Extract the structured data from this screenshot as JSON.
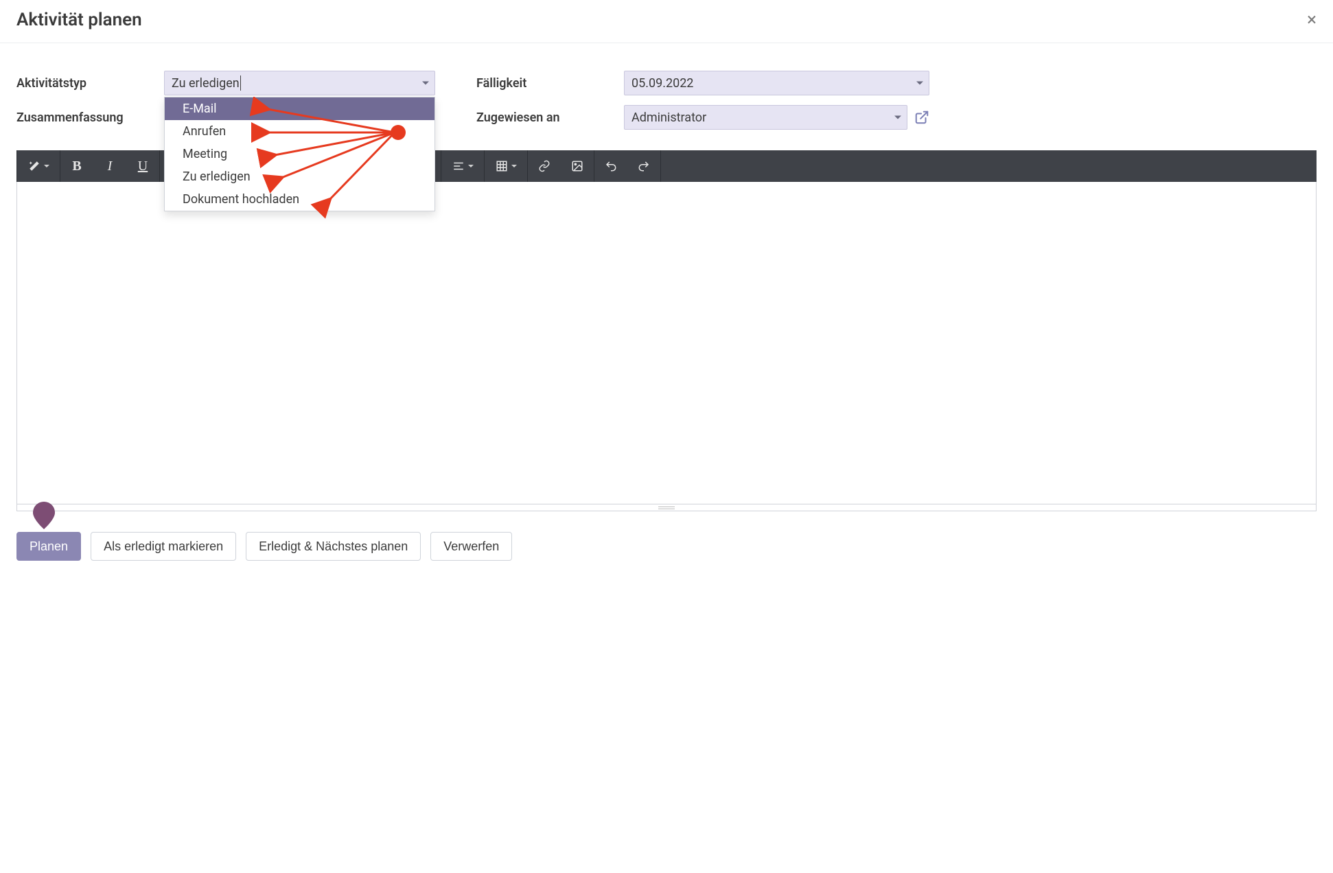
{
  "dialog": {
    "title": "Aktivität planen"
  },
  "form": {
    "activityType": {
      "label": "Aktivitätstyp",
      "value": "Zu erledigen"
    },
    "summary": {
      "label": "Zusammenfassung",
      "value": ""
    },
    "dueDate": {
      "label": "Fälligkeit",
      "value": "05.09.2022"
    },
    "assignedTo": {
      "label": "Zugewiesen an",
      "value": "Administrator"
    }
  },
  "activityTypeOptions": [
    "E-Mail",
    "Anrufen",
    "Meeting",
    "Zu erledigen",
    "Dokument hochladen"
  ],
  "footer": {
    "plan": "Planen",
    "markDone": "Als erledigt markieren",
    "doneNext": "Erledigt & Nächstes planen",
    "discard": "Verwerfen"
  },
  "icons": {
    "close": "×"
  }
}
